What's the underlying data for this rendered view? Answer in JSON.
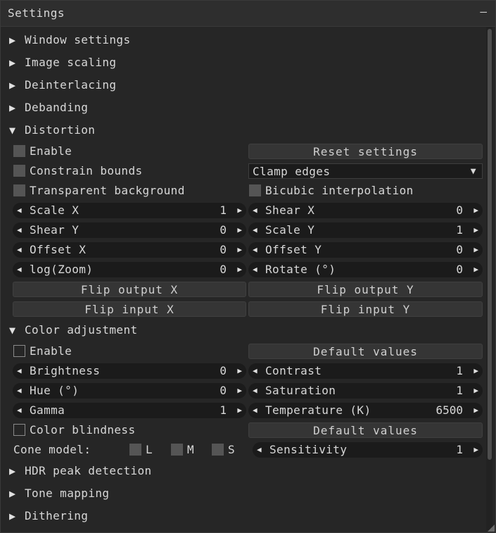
{
  "window": {
    "title": "Settings",
    "collapse_glyph": "–"
  },
  "sections": {
    "window_settings": "Window settings",
    "image_scaling": "Image scaling",
    "deinterlacing": "Deinterlacing",
    "debanding": "Debanding",
    "distortion": "Distortion",
    "color_adjustment": "Color adjustment",
    "hdr_peak": "HDR peak detection",
    "tone_mapping": "Tone mapping",
    "dithering": "Dithering"
  },
  "icons": {
    "collapsed": "▶",
    "expanded": "▼",
    "combo_arrow": "▼",
    "step_left": "◀",
    "step_right": "▶"
  },
  "distortion": {
    "enable": "Enable",
    "reset": "Reset settings",
    "constrain": "Constrain bounds",
    "clamp": "Clamp edges",
    "transparent": "Transparent background",
    "bicubic": "Bicubic interpolation",
    "scale_x": {
      "label": "Scale X",
      "value": "1"
    },
    "shear_x": {
      "label": "Shear X",
      "value": "0"
    },
    "shear_y": {
      "label": "Shear Y",
      "value": "0"
    },
    "scale_y": {
      "label": "Scale Y",
      "value": "1"
    },
    "offset_x": {
      "label": "Offset X",
      "value": "0"
    },
    "offset_y": {
      "label": "Offset Y",
      "value": "0"
    },
    "log_zoom": {
      "label": "log(Zoom)",
      "value": "0"
    },
    "rotate": {
      "label": "Rotate (°)",
      "value": "0"
    },
    "flip_out_x": "Flip output X",
    "flip_out_y": "Flip output Y",
    "flip_in_x": "Flip input X",
    "flip_in_y": "Flip input Y"
  },
  "color": {
    "enable": "Enable",
    "defaults": "Default values",
    "brightness": {
      "label": "Brightness",
      "value": "0"
    },
    "contrast": {
      "label": "Contrast",
      "value": "1"
    },
    "hue": {
      "label": "Hue (°)",
      "value": "0"
    },
    "saturation": {
      "label": "Saturation",
      "value": "1"
    },
    "gamma": {
      "label": "Gamma",
      "value": "1"
    },
    "temperature": {
      "label": "Temperature (K)",
      "value": "6500"
    },
    "blindness": "Color blindness",
    "defaults2": "Default values",
    "cone_model": "Cone model:",
    "cone_l": "L",
    "cone_m": "M",
    "cone_s": "S",
    "sensitivity": {
      "label": "Sensitivity",
      "value": "1"
    }
  },
  "colors": {
    "window_bg": "#262626",
    "title_bg": "#2e2e2e",
    "widget_bg": "#1b1b1b",
    "checkbox": "#555555",
    "text": "#d8d8d8"
  }
}
